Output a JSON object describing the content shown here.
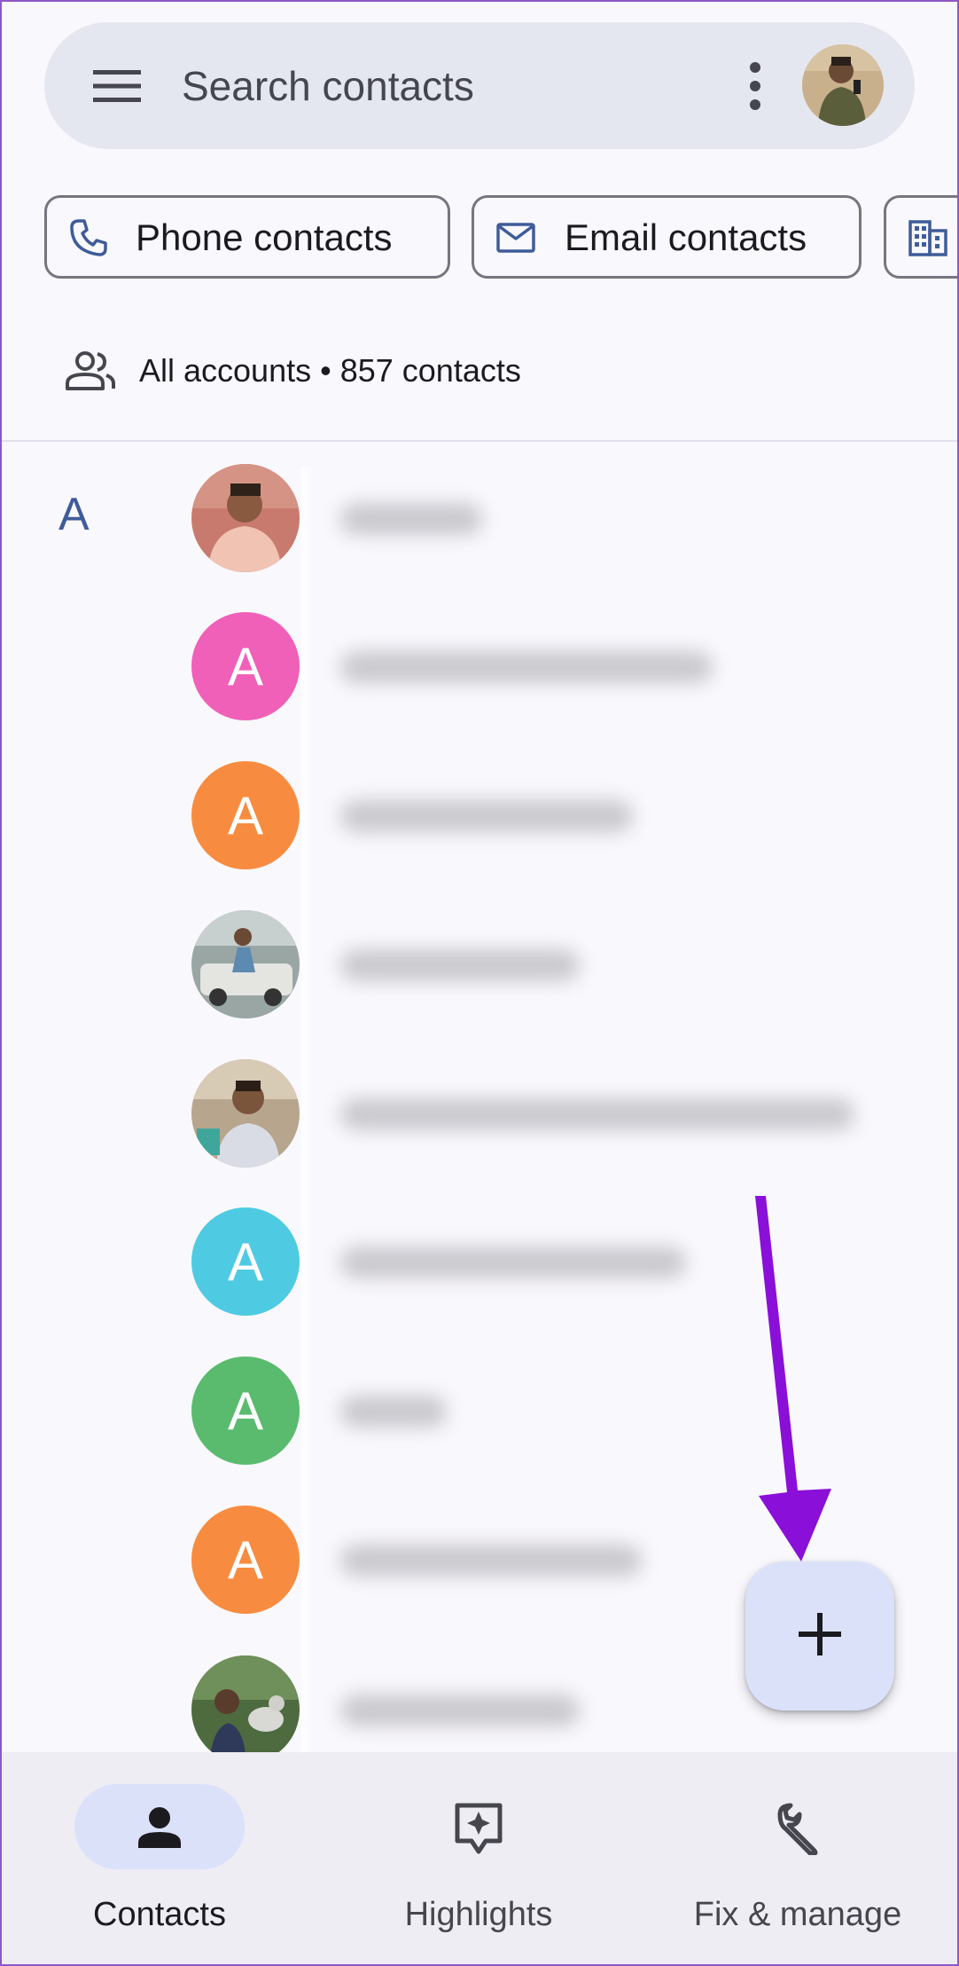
{
  "search": {
    "placeholder": "Search contacts",
    "menu_icon": "hamburger-menu-icon",
    "more_icon": "more-vert-icon",
    "account_avatar": "account-avatar"
  },
  "chips": [
    {
      "label": "Phone contacts",
      "icon": "phone-icon"
    },
    {
      "label": "Email contacts",
      "icon": "mail-icon"
    },
    {
      "label": "",
      "icon": "business-icon"
    }
  ],
  "accounts": {
    "icon": "people-icon",
    "summary": "All accounts • 857 contacts"
  },
  "contacts": {
    "section_letter": "A",
    "rows": [
      {
        "avatar_type": "photo",
        "avatar_letter": "",
        "avatar_color": "#b9836a"
      },
      {
        "avatar_type": "letter",
        "avatar_letter": "A",
        "avatar_color": "#f060b8"
      },
      {
        "avatar_type": "letter",
        "avatar_letter": "A",
        "avatar_color": "#f78c40"
      },
      {
        "avatar_type": "photo",
        "avatar_letter": "",
        "avatar_color": "#8a8d8c"
      },
      {
        "avatar_type": "photo",
        "avatar_letter": "",
        "avatar_color": "#6e5a4c"
      },
      {
        "avatar_type": "letter",
        "avatar_letter": "A",
        "avatar_color": "#4ecbe2"
      },
      {
        "avatar_type": "letter",
        "avatar_letter": "A",
        "avatar_color": "#5abb6e"
      },
      {
        "avatar_type": "letter",
        "avatar_letter": "A",
        "avatar_color": "#f78c40"
      },
      {
        "avatar_type": "photo",
        "avatar_letter": "",
        "avatar_color": "#4d6b3f"
      }
    ]
  },
  "fab": {
    "icon": "add-icon"
  },
  "bottom_nav": {
    "items": [
      {
        "label": "Contacts",
        "icon": "person-icon",
        "active": true
      },
      {
        "label": "Highlights",
        "icon": "highlights-icon",
        "active": false
      },
      {
        "label": "Fix & manage",
        "icon": "wrench-icon",
        "active": false
      }
    ]
  },
  "colors": {
    "background": "#f9f8fd",
    "search_bar": "#e5e7f0",
    "accent_letter": "#3f5c99",
    "fab": "#dbe1f9",
    "nav_active_pill": "#dce1fa",
    "annotation_arrow": "#8a0fd8"
  }
}
